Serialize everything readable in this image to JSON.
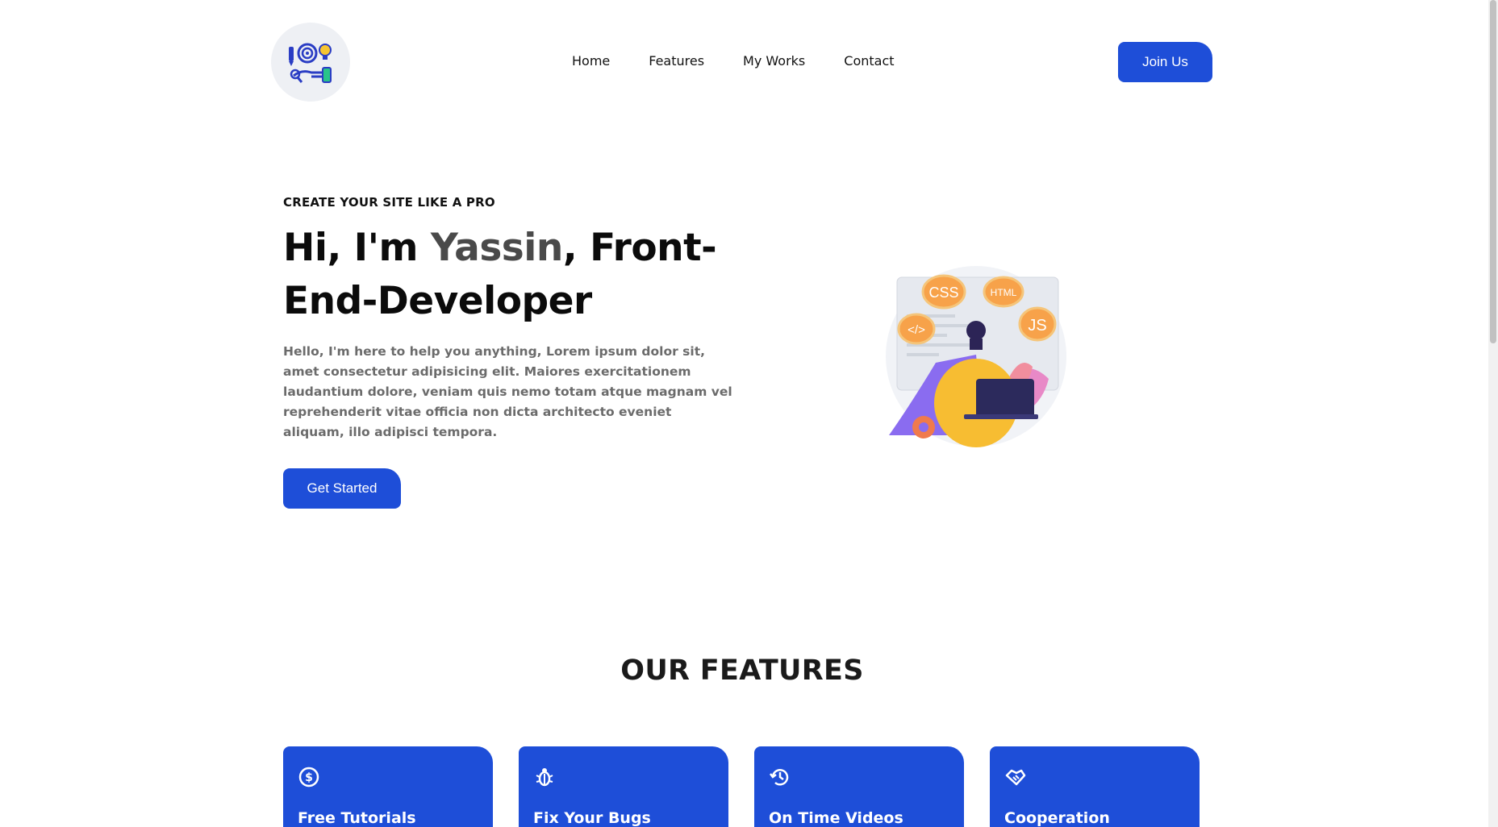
{
  "nav": {
    "items": [
      {
        "label": "Home"
      },
      {
        "label": "Features"
      },
      {
        "label": "My Works"
      },
      {
        "label": "Contact"
      }
    ],
    "join_label": "Join Us"
  },
  "hero": {
    "eyebrow": "CREATE YOUR SITE LIKE A PRO",
    "title_prefix": "Hi, I'm ",
    "title_name": "Yassin",
    "title_suffix": ", Front-End-Developer",
    "description": "Hello, I'm here to help you anything, Lorem ipsum dolor sit, amet consectetur adipisicing elit. Maiores exercitationem laudantium dolore, veniam quis nemo totam atque magnam vel reprehenderit vitae officia non dicta architecto eveniet aliquam, illo adipisci tempora.",
    "cta_label": "Get Started",
    "illustration_tags": [
      "CSS",
      "HTML",
      "JS",
      "</>"
    ]
  },
  "features": {
    "title": "OUR FEATURES",
    "cards": [
      {
        "title": "Free Tutorials",
        "icon": "dollar-coin-icon"
      },
      {
        "title": "Fix Your Bugs",
        "icon": "bug-icon"
      },
      {
        "title": "On Time Videos",
        "icon": "history-clock-icon"
      },
      {
        "title": "Cooperation",
        "icon": "handshake-icon"
      }
    ]
  },
  "colors": {
    "primary": "#1e4ed8",
    "text": "#111111",
    "muted": "#6b6b6b",
    "accent_name": "#4a4a4a"
  }
}
